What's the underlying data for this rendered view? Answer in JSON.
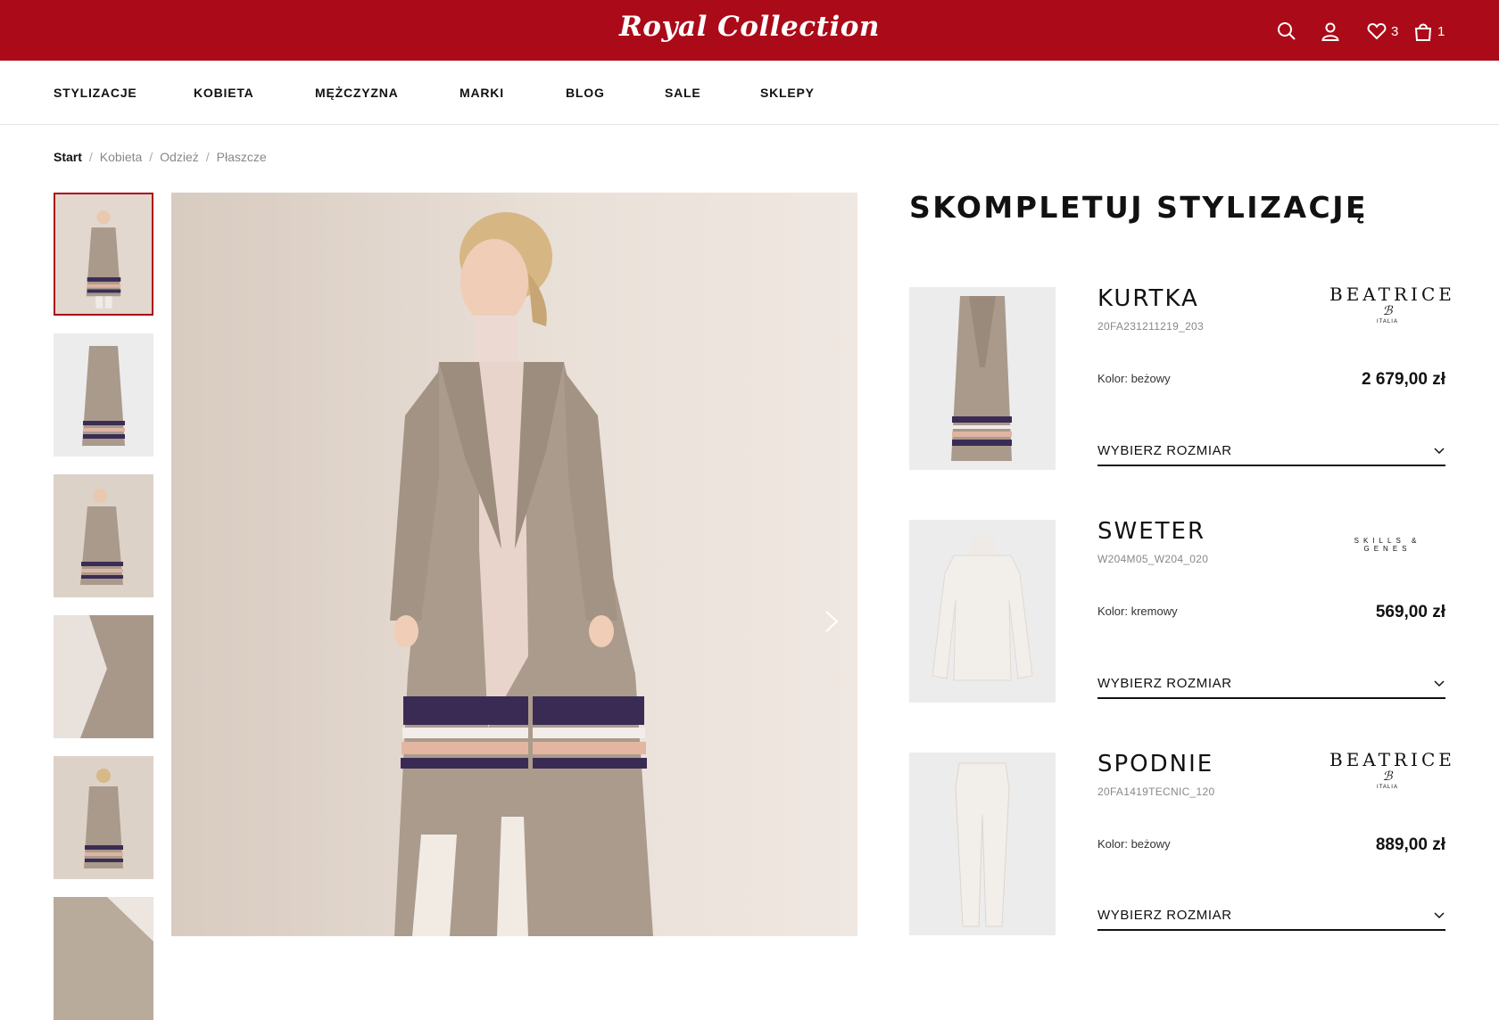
{
  "header": {
    "logo": "Royal Collection",
    "wishlist_count": "3",
    "cart_count": "1",
    "icons": [
      "search-icon",
      "user-icon",
      "heart-icon",
      "bag-icon"
    ],
    "bg_color": "#ab0a18"
  },
  "nav": {
    "items": [
      "STYLIZACJE",
      "KOBIETA",
      "MĘŻCZYZNA",
      "MARKI",
      "BLOG",
      "SALE",
      "SKLEPY"
    ]
  },
  "breadcrumb": {
    "items": [
      "Start",
      "Kobieta",
      "Odzież",
      "Płaszcze"
    ],
    "separator": "/"
  },
  "gallery": {
    "thumbnail_count": 6,
    "active_index": 0
  },
  "complete_look": {
    "title": "SKOMPLETUJ STYLIZACJĘ",
    "products": [
      {
        "name": "KURTKA",
        "sku": "20FA231211219_203",
        "brand": "BEATRICE",
        "brand_sub": "ITALIA",
        "color": "Kolor: beżowy",
        "price": "2 679,00 zł",
        "size_label": "WYBIERZ ROZMIAR"
      },
      {
        "name": "SWETER",
        "sku": "W204M05_W204_020",
        "brand": "SKILLS & GENES",
        "color": "Kolor: kremowy",
        "price": "569,00 zł",
        "size_label": "WYBIERZ ROZMIAR"
      },
      {
        "name": "SPODNIE",
        "sku": "20FA1419TECNIC_120",
        "brand": "BEATRICE",
        "brand_sub": "ITALIA",
        "color": "Kolor: beżowy",
        "price": "889,00 zł",
        "size_label": "WYBIERZ ROZMIAR"
      }
    ]
  }
}
